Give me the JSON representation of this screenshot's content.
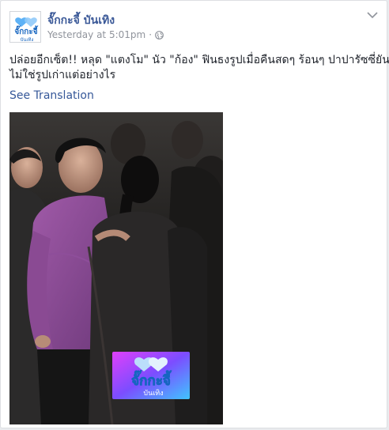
{
  "post": {
    "page_name": "จั๊กกะจี้ บันเทิง",
    "timestamp": "Yesterday at 5:01pm",
    "separator": "·",
    "privacy_icon": "globe-icon",
    "menu_icon": "chevron-down-icon",
    "text_line1": "ปล่อยอีกเซ็ต!! หลุด \"แตงโม\" นัว \"ก้อง\" ฟินธงรูปเมื่อคืนสดๆ ร้อนๆ ปาปารัซซี่ยัน",
    "text_line2": "ไม่ใช่รูปเก่าแต่อย่างไร",
    "see_translation": "See Translation"
  },
  "avatar": {
    "logo_line1": "จั๊กกะจี้",
    "logo_line2": "บันเทิง"
  },
  "watermark": {
    "logo_line1": "จั๊กกะจี้",
    "logo_line2": "บันเทิง"
  },
  "colors": {
    "link": "#365899",
    "name": "#3b5998",
    "meta": "#90949c",
    "text": "#1d2129",
    "logo_blue": "#1e88e5",
    "watermark_pink": "#e040fb",
    "watermark_cyan": "#40c4ff"
  }
}
